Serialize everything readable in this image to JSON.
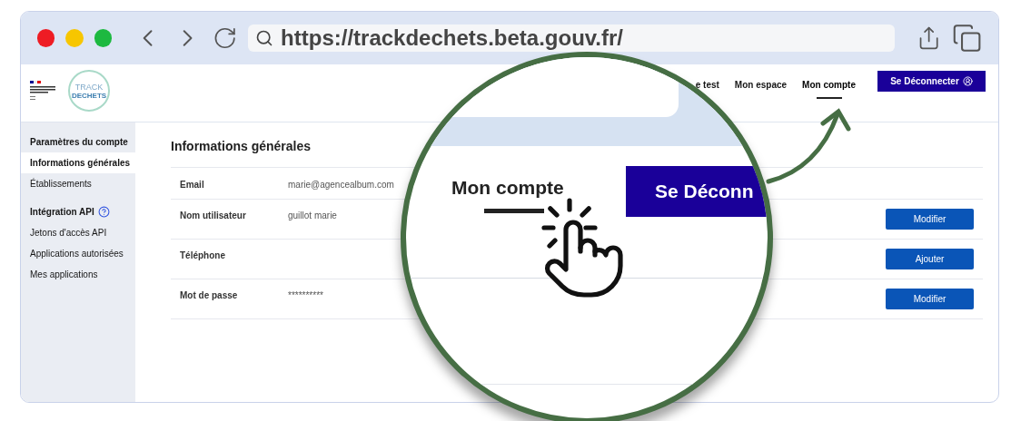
{
  "browser": {
    "url": "https://trackdechets.beta.gouv.fr/"
  },
  "header": {
    "logo_text": [
      "TRACK",
      "DECHETS"
    ],
    "nav": [
      {
        "label": "e test",
        "selected": false
      },
      {
        "label": "Mon espace",
        "selected": false
      },
      {
        "label": "Mon compte",
        "selected": true
      }
    ],
    "logout_button": "Se Déconnecter"
  },
  "sidebar": {
    "items": [
      {
        "label": "Paramètres du compte",
        "kind": "heading",
        "selected": false
      },
      {
        "label": "Informations générales",
        "kind": "link",
        "selected": true
      },
      {
        "label": "Établissements",
        "kind": "link",
        "selected": false
      },
      {
        "label": "Intégration API",
        "kind": "heading_help",
        "selected": false
      },
      {
        "label": "Jetons d'accès API",
        "kind": "link",
        "selected": false
      },
      {
        "label": "Applications autorisées",
        "kind": "link",
        "selected": false
      },
      {
        "label": "Mes applications",
        "kind": "link",
        "selected": false
      }
    ]
  },
  "main": {
    "title": "Informations générales",
    "rows": [
      {
        "label": "Email",
        "value": "marie@agencealbum.com"
      },
      {
        "label": "Nom utilisateur",
        "value": "guillot marie",
        "action": "Modifier"
      },
      {
        "label": "Téléphone",
        "action": "Ajouter"
      },
      {
        "label": "Mot de passe",
        "value": "**********",
        "action": "Modifier"
      }
    ]
  },
  "magnifier": {
    "label": "Mon compte",
    "selected": true,
    "button": "Se Déconn"
  }
}
